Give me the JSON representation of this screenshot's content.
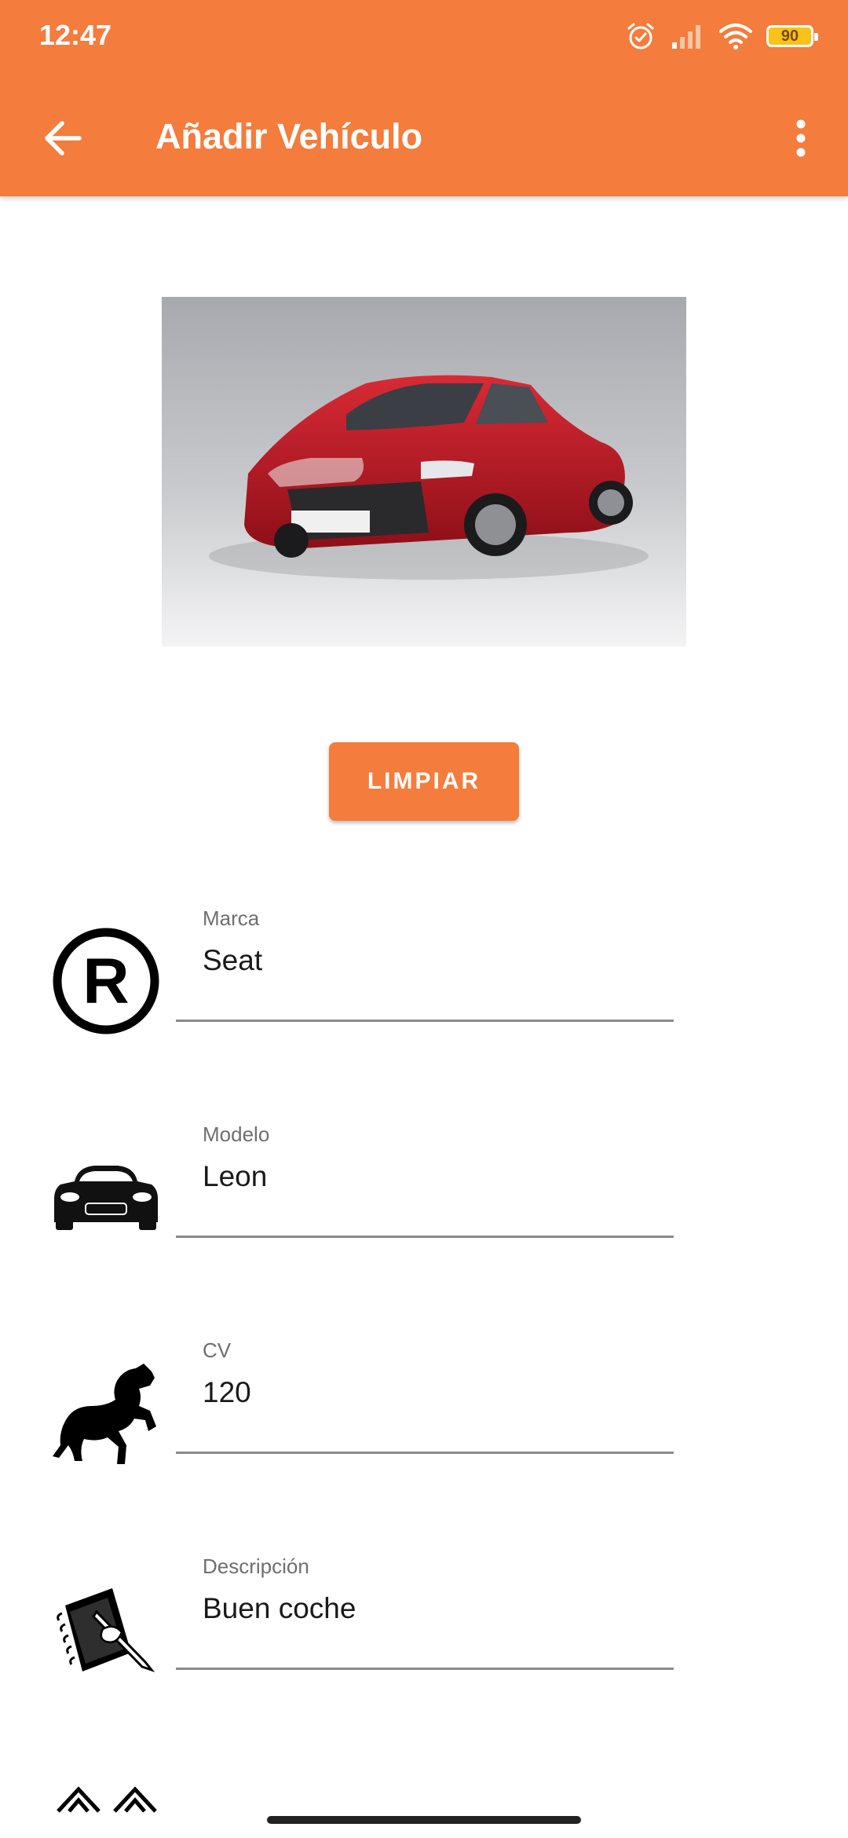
{
  "status_bar": {
    "time": "12:47",
    "battery": "90",
    "icons": [
      "alarm-icon",
      "signal-icon",
      "wifi-icon",
      "battery-icon"
    ]
  },
  "toolbar": {
    "title": "Añadir Vehículo",
    "back_icon": "arrow-left-icon",
    "menu_icon": "more-vert-icon"
  },
  "image": {
    "description": "red-car-photo"
  },
  "actions": {
    "clear_label": "LIMPIAR"
  },
  "fields": [
    {
      "label": "Marca",
      "value": "Seat",
      "icon": "registered-trademark-icon"
    },
    {
      "label": "Modelo",
      "value": "Leon",
      "icon": "car-front-icon"
    },
    {
      "label": "CV",
      "value": "120",
      "icon": "horse-icon"
    },
    {
      "label": "Descripción",
      "value": "Buen coche",
      "icon": "notebook-pencil-icon"
    }
  ],
  "colors": {
    "accent": "#F47C3C",
    "status_battery": "#F8C21A"
  }
}
